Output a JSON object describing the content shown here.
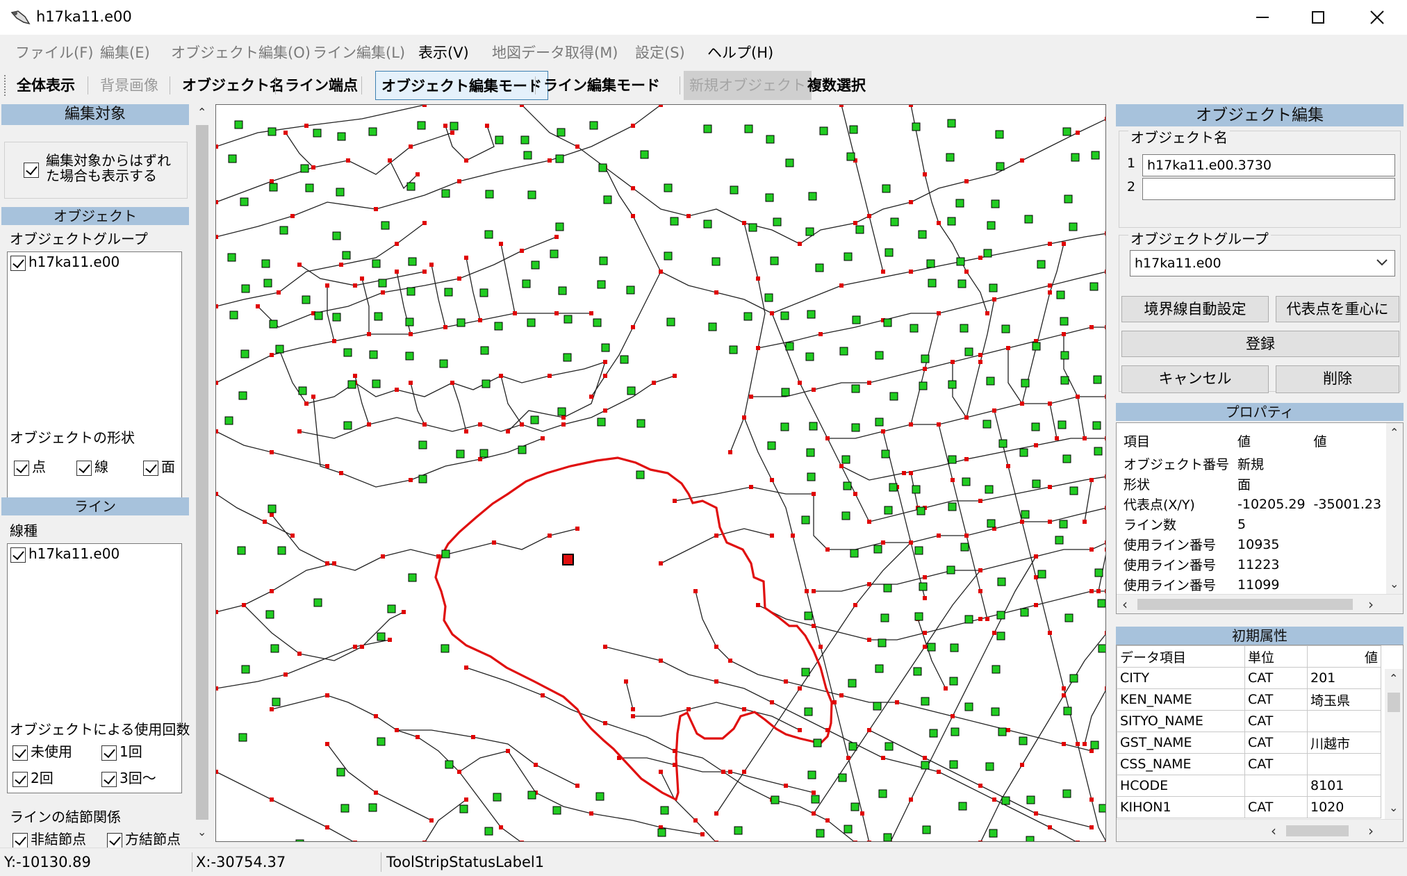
{
  "window": {
    "title": "h17ka11.e00"
  },
  "menu": [
    "ファイル(F)",
    "編集(E)",
    "オブジェクト編集(O)",
    "ライン編集(L)",
    "表示(V)",
    "地図データ取得(M)",
    "設定(S)",
    "ヘルプ(H)"
  ],
  "toolbar": {
    "show_all": "全体表示",
    "background_image": "背景画像",
    "object_name": "オブジェクト名",
    "line_endpoint": "ライン端点",
    "object_edit_mode": "オブジェクト編集モード",
    "line_edit_mode": "ライン編集モード",
    "new_object": "新規オブジェクト",
    "multi_select": "複数選択"
  },
  "left": {
    "edit_target_header": "編集対象",
    "show_outside_label_1": "編集対象からはずれ",
    "show_outside_label_2": "た場合も表示する",
    "object_header": "オブジェクト",
    "object_group_label": "オブジェクトグループ",
    "object_group_items": [
      "h17ka11.e00"
    ],
    "shape_label": "オブジェクトの形状",
    "shape_point": "点",
    "shape_line": "線",
    "shape_face": "面",
    "line_header": "ライン",
    "line_type_label": "線種",
    "line_type_items": [
      "h17ka11.e00"
    ],
    "usage_label": "オブジェクトによる使用回数",
    "usage_unused": "未使用",
    "usage_1": "1回",
    "usage_2": "2回",
    "usage_3": "3回〜",
    "junction_label": "ラインの結節関係",
    "junction_non": "非結節点",
    "junction_yes": "方結節点"
  },
  "right": {
    "header": "オブジェクト編集",
    "object_name_label": "オブジェクト名",
    "name_row1_num": "1",
    "name_row1_value": "h17ka11.e00.3730",
    "name_row2_num": "2",
    "name_row2_value": "",
    "object_group_label": "オブジェクトグループ",
    "object_group_value": "h17ka11.e00",
    "btn_auto_boundary": "境界線自動設定",
    "btn_centroid": "代表点を重心に",
    "btn_register": "登録",
    "btn_cancel": "キャンセル",
    "btn_delete": "削除",
    "properties_header": "プロパティ",
    "properties_columns": [
      "項目",
      "値",
      "値"
    ],
    "properties_rows": [
      [
        "オブジェクト番号",
        "新規",
        ""
      ],
      [
        "形状",
        "面",
        ""
      ],
      [
        "代表点(X/Y)",
        "-10205.29",
        "-35001.23"
      ],
      [
        "ライン数",
        "5",
        ""
      ],
      [
        "使用ライン番号",
        "10935",
        ""
      ],
      [
        "使用ライン番号",
        "11223",
        ""
      ],
      [
        "使用ライン番号",
        "11099",
        ""
      ]
    ],
    "initial_attr_header": "初期属性",
    "attr_columns": [
      "データ項目",
      "単位",
      "値"
    ],
    "attr_rows": [
      [
        "CITY",
        "CAT",
        "201"
      ],
      [
        "KEN_NAME",
        "CAT",
        "埼玉県"
      ],
      [
        "SITYO_NAME",
        "CAT",
        ""
      ],
      [
        "GST_NAME",
        "CAT",
        "川越市"
      ],
      [
        "CSS_NAME",
        "CAT",
        ""
      ],
      [
        "HCODE",
        "",
        "8101"
      ],
      [
        "KIHON1",
        "CAT",
        "1020"
      ]
    ]
  },
  "status": {
    "y": "Y:-10130.89",
    "x": "X:-30754.37",
    "label": "ToolStripStatusLabel1"
  },
  "colors": {
    "selected_boundary": "#e01010",
    "node": "#e00000",
    "centroid": "#22cc22",
    "panel_header": "#a7c2dc"
  }
}
